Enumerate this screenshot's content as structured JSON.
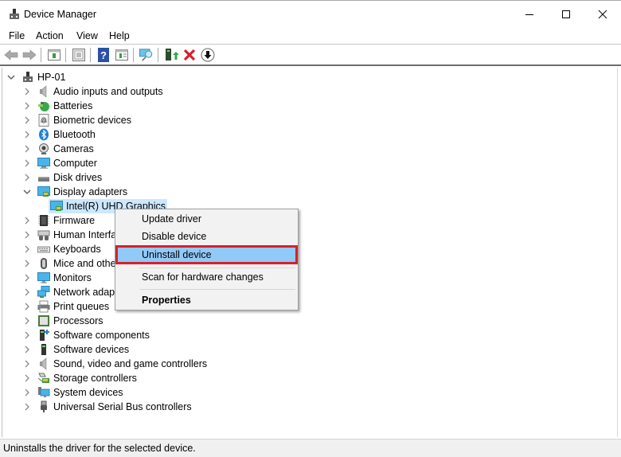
{
  "window": {
    "title": "Device Manager",
    "controls": {
      "minimize": "minimize",
      "maximize": "maximize",
      "close": "close"
    }
  },
  "menubar": {
    "items": [
      {
        "label": "File"
      },
      {
        "label": "Action"
      },
      {
        "label": "View"
      },
      {
        "label": "Help"
      }
    ]
  },
  "toolbar": {
    "icons": [
      "back-icon",
      "forward-icon",
      "show-hide-console-tree-icon",
      "properties-icon",
      "help-icon",
      "show-action-pane-icon",
      "scan-hardware-icon",
      "update-driver-icon",
      "uninstall-icon",
      "disable-device-icon"
    ]
  },
  "tree": {
    "root": {
      "label": "HP-01",
      "expanded": true
    },
    "categories": [
      {
        "label": "Audio inputs and outputs",
        "icon": "speaker-icon",
        "expanded": false
      },
      {
        "label": "Batteries",
        "icon": "battery-icon",
        "expanded": false
      },
      {
        "label": "Biometric devices",
        "icon": "fingerprint-icon",
        "expanded": false
      },
      {
        "label": "Bluetooth",
        "icon": "bluetooth-icon",
        "expanded": false
      },
      {
        "label": "Cameras",
        "icon": "camera-icon",
        "expanded": false
      },
      {
        "label": "Computer",
        "icon": "computer-icon",
        "expanded": false
      },
      {
        "label": "Disk drives",
        "icon": "disk-drive-icon",
        "expanded": false
      },
      {
        "label": "Display adapters",
        "icon": "display-adapter-icon",
        "expanded": true,
        "children": [
          {
            "label": "Intel(R) UHD Graphics",
            "selected": true
          }
        ]
      },
      {
        "label": "Firmware",
        "icon": "firmware-icon",
        "expanded": false
      },
      {
        "label": "Human Interfa",
        "icon": "hid-icon",
        "expanded": false
      },
      {
        "label": "Keyboards",
        "icon": "keyboard-icon",
        "expanded": false
      },
      {
        "label": "Mice and other",
        "icon": "mouse-icon",
        "expanded": false
      },
      {
        "label": "Monitors",
        "icon": "monitor-icon",
        "expanded": false
      },
      {
        "label": "Network adapt",
        "icon": "network-icon",
        "expanded": false
      },
      {
        "label": "Print queues",
        "icon": "printer-icon",
        "expanded": false
      },
      {
        "label": "Processors",
        "icon": "processor-icon",
        "expanded": false
      },
      {
        "label": "Software components",
        "icon": "software-component-icon",
        "expanded": false
      },
      {
        "label": "Software devices",
        "icon": "software-device-icon",
        "expanded": false
      },
      {
        "label": "Sound, video and game controllers",
        "icon": "speaker-icon",
        "expanded": false
      },
      {
        "label": "Storage controllers",
        "icon": "storage-controller-icon",
        "expanded": false
      },
      {
        "label": "System devices",
        "icon": "system-devices-icon",
        "expanded": false
      },
      {
        "label": "Universal Serial Bus controllers",
        "icon": "usb-icon",
        "expanded": false
      }
    ]
  },
  "context_menu": {
    "items": [
      {
        "label": "Update driver"
      },
      {
        "label": "Disable device"
      },
      {
        "label": "Uninstall device",
        "highlighted": true
      },
      {
        "label": "Scan for hardware changes"
      },
      {
        "label": "Properties",
        "bold": true
      }
    ],
    "highlight_color": "#91c9f7",
    "outline_color": "#d8202d"
  },
  "statusbar": {
    "text": "Uninstalls the driver for the selected device."
  }
}
